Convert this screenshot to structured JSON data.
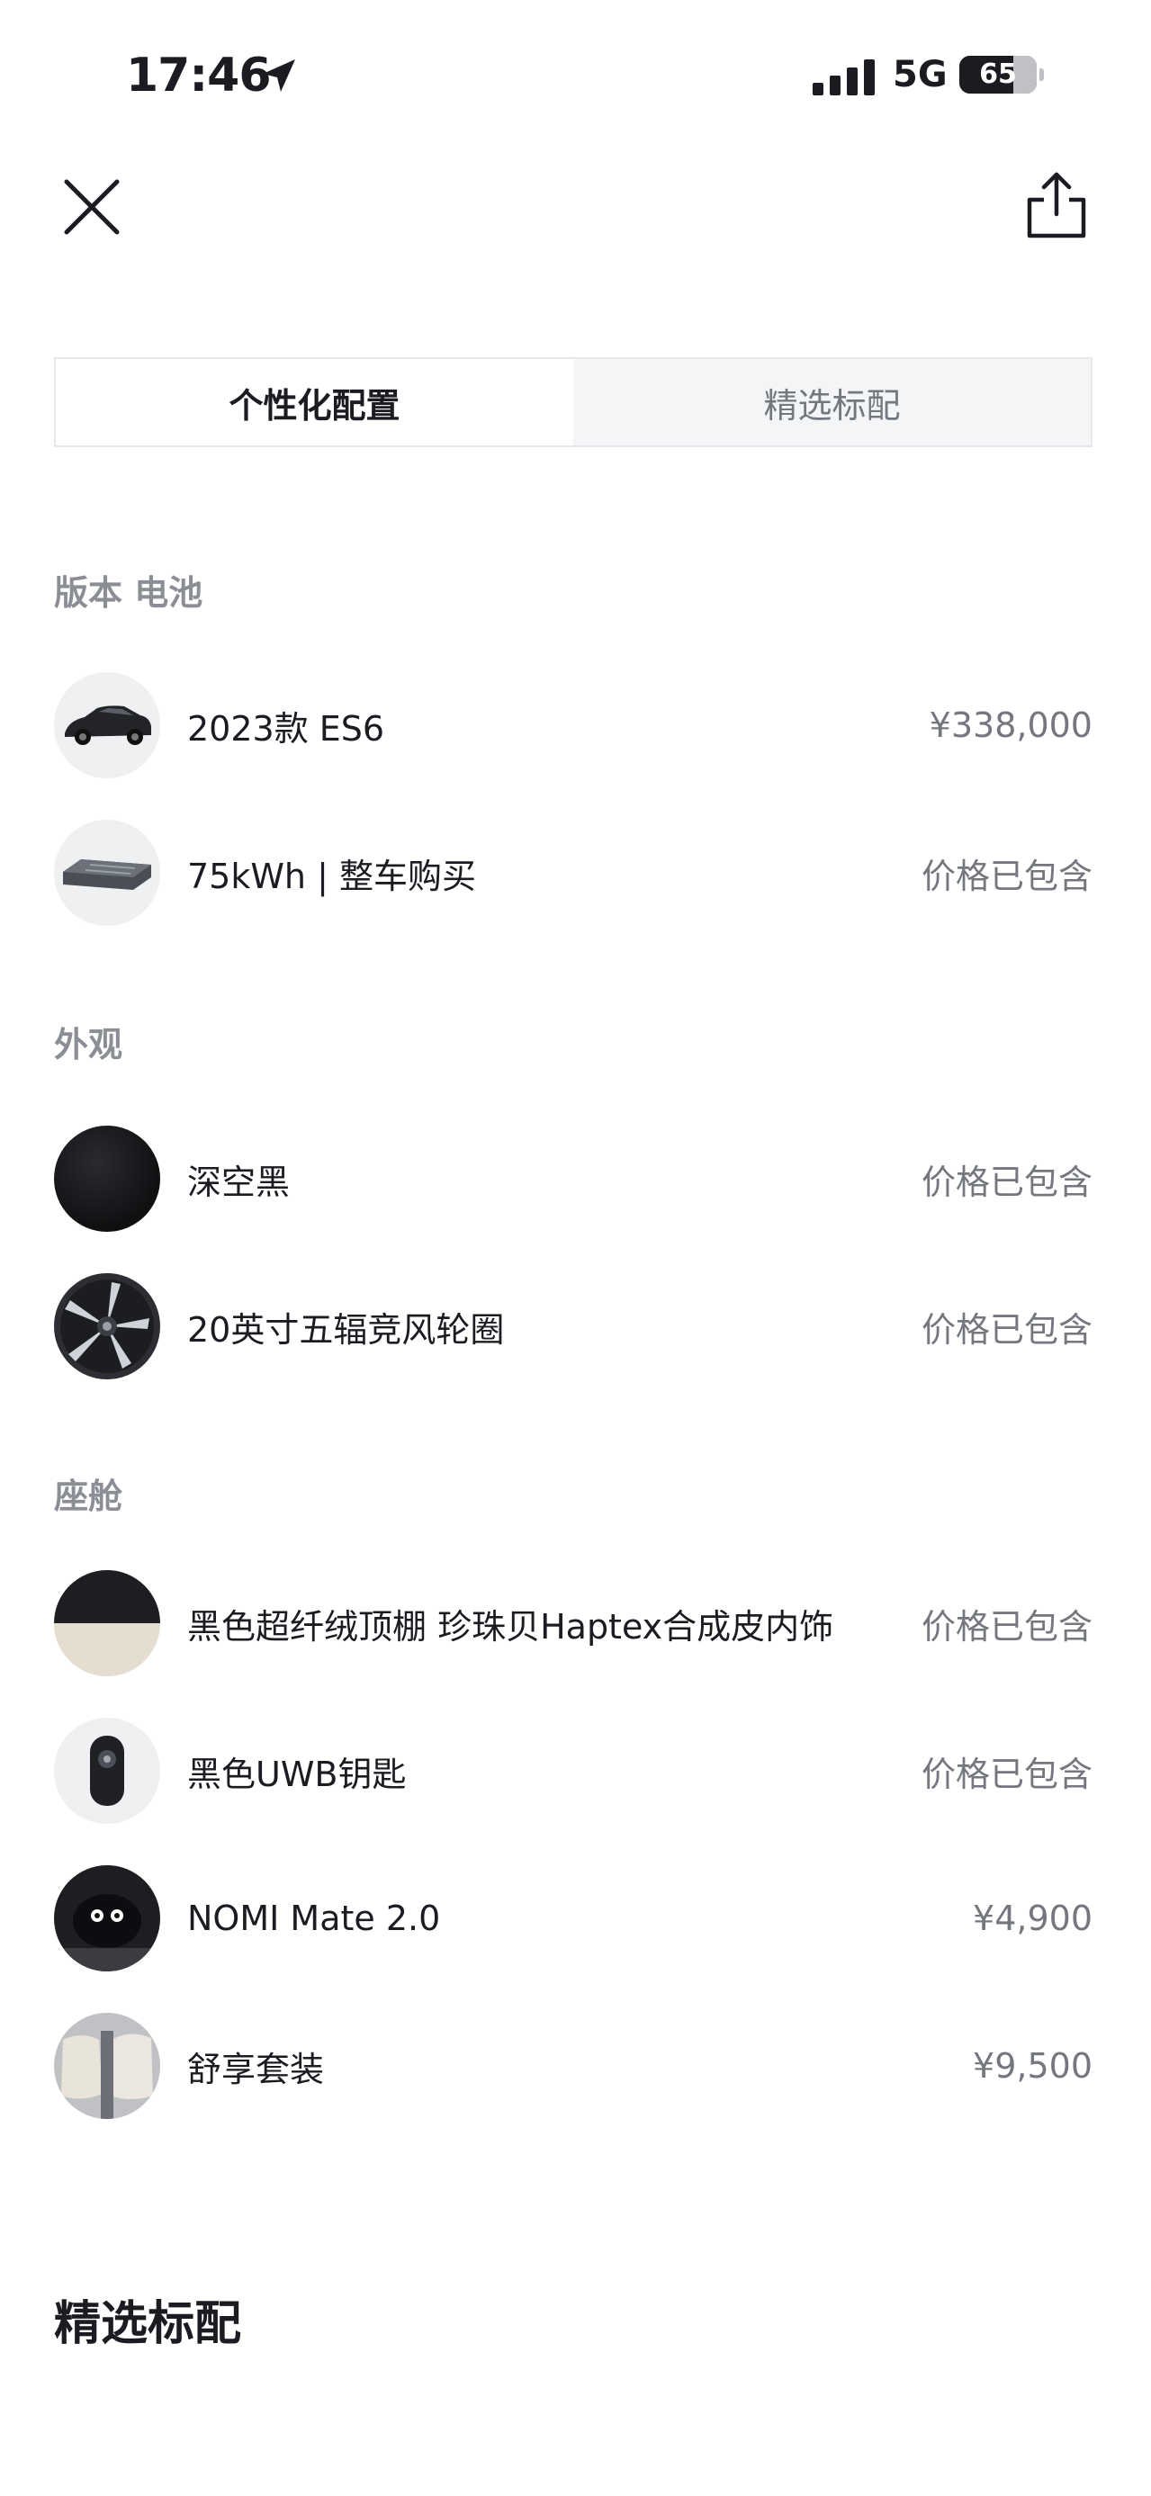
{
  "status_bar": {
    "time": "17:46",
    "network": "5G",
    "battery": "65"
  },
  "tabs": [
    {
      "label": "个性化配置",
      "active": true
    },
    {
      "label": "精选标配",
      "active": false
    }
  ],
  "sections": [
    {
      "title": "版本 电池",
      "items": [
        {
          "icon": "car-thumbnail",
          "label": "2023款 ES6",
          "price": "¥338,000"
        },
        {
          "icon": "battery-pack-thumbnail",
          "label": "75kWh | 整车购买",
          "price": "价格已包含"
        }
      ]
    },
    {
      "title": "外观",
      "items": [
        {
          "icon": "color-swatch-black",
          "label": "深空黑",
          "price": "价格已包含"
        },
        {
          "icon": "wheel-thumbnail",
          "label": "20英寸五辐竞风轮圈",
          "price": "价格已包含"
        }
      ]
    },
    {
      "title": "座舱",
      "items": [
        {
          "icon": "interior-swatch",
          "label": "黑色超纤绒顶棚 珍珠贝Haptex合成皮内饰",
          "price": "价格已包含"
        },
        {
          "icon": "uwb-key-thumbnail",
          "label": "黑色UWB钥匙",
          "price": "价格已包含"
        },
        {
          "icon": "nomi-thumbnail",
          "label": "NOMI Mate 2.0",
          "price": "¥4,900"
        },
        {
          "icon": "seat-thumbnail",
          "label": "舒享套装",
          "price": "¥9,500"
        }
      ]
    }
  ],
  "bottom_title": "精选标配"
}
